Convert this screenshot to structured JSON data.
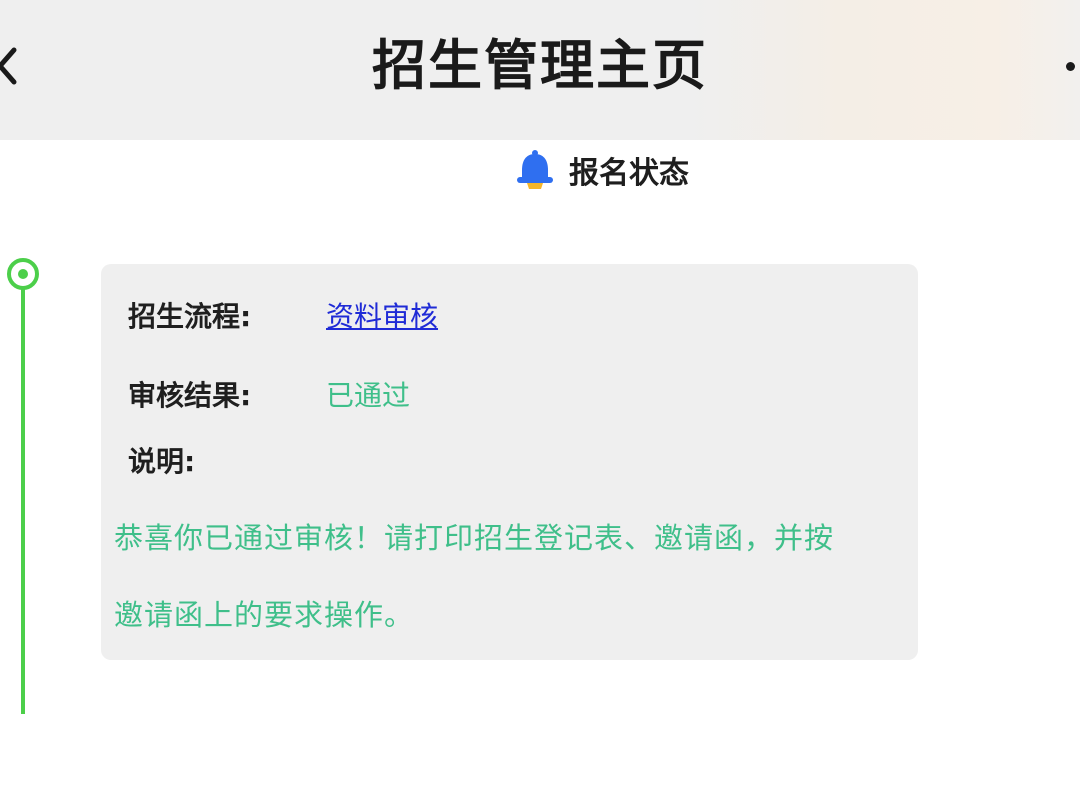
{
  "header": {
    "title": "招生管理主页",
    "back_icon": "chevron-left-icon",
    "more_icon": "more-dots-icon"
  },
  "section": {
    "title": "报名状态",
    "icon": "bell-icon"
  },
  "status_card": {
    "process_label": "招生流程:",
    "process_value": "资料审核",
    "result_label": "审核结果:",
    "result_value": "已通过",
    "note_label": "说明:",
    "note_line1": "恭喜你已通过审核！请打印招生登记表、邀请函，并按",
    "note_line2": "邀请函上的要求操作。"
  },
  "colors": {
    "timeline": "#4ccf4a",
    "link": "#1f2bd6",
    "success_text": "#3fbf8a",
    "bell": "#2f6ff0",
    "bell_base": "#f5b62a"
  }
}
